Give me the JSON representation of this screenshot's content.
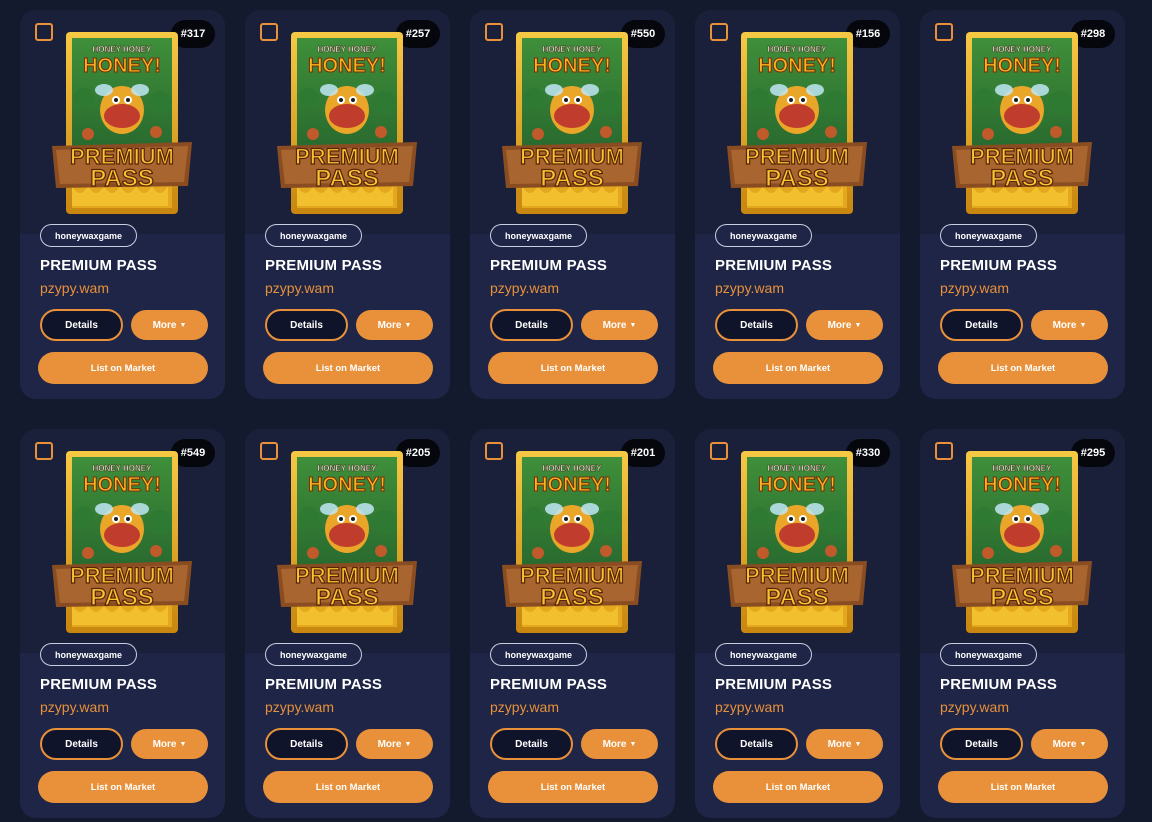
{
  "colors": {
    "page_bg": "#141a2e",
    "card_bg": "#1e2546",
    "card_top_bg": "#1a2039",
    "accent": "#e8913a",
    "text": "#ffffff"
  },
  "icons": {
    "checkbox": "checkbox-icon",
    "dropdown": "caret-down-icon"
  },
  "common": {
    "collection": "honeywaxgame",
    "title": "PREMIUM PASS",
    "owner": "pzypy.wam",
    "details_label": "Details",
    "more_label": "More",
    "list_label": "List on Market",
    "art_top_text": "HONEY HONEY",
    "art_main_text": "HONEY!",
    "art_banner_1": "PREMIUM",
    "art_banner_2": "PASS"
  },
  "cards": [
    {
      "number": "#317"
    },
    {
      "number": "#257"
    },
    {
      "number": "#550"
    },
    {
      "number": "#156"
    },
    {
      "number": "#298"
    },
    {
      "number": "#549"
    },
    {
      "number": "#205"
    },
    {
      "number": "#201"
    },
    {
      "number": "#330"
    },
    {
      "number": "#295"
    }
  ]
}
